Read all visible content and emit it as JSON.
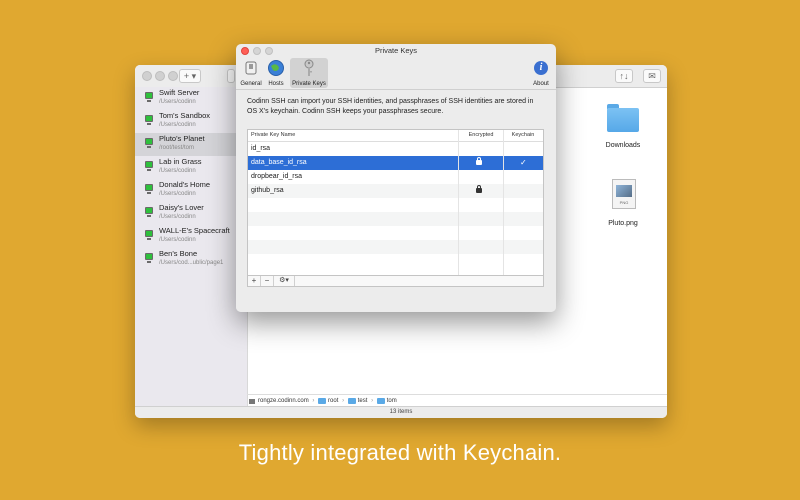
{
  "background_window": {
    "toolbar": {
      "add_label": "+",
      "sort_label": "↑↓"
    },
    "sidebar": {
      "items": [
        {
          "name": "Swift Server",
          "path": "/Users/codinn"
        },
        {
          "name": "Tom's Sandbox",
          "path": "/Users/codinn"
        },
        {
          "name": "Pluto's Planet",
          "path": "/root/test/tom",
          "selected": true
        },
        {
          "name": "Lab in Grass",
          "path": "/Users/codinn"
        },
        {
          "name": "Donald's Home",
          "path": "/Users/codinn"
        },
        {
          "name": "Daisy's Lover",
          "path": "/Users/codinn"
        },
        {
          "name": "WALL-E's Spacecraft",
          "path": "/Users/codinn"
        },
        {
          "name": "Ben's Bone",
          "path": "/Users/cod...ublic/page1"
        }
      ]
    },
    "files": {
      "downloads": "Downloads",
      "pluto_png": "Pluto.png",
      "png_badge": "PNG"
    },
    "path_bar": {
      "host": "rongze.codinn.com",
      "parts": [
        "root",
        "test",
        "tom"
      ],
      "separator": "›"
    },
    "status": "13 items"
  },
  "prefs": {
    "title": "Private Keys",
    "tabs": {
      "general": "General",
      "hosts": "Hosts",
      "private_keys": "Private Keys",
      "about": "About"
    },
    "description": "Codinn SSH can import your SSH identities, and passphrases of SSH identities are stored in OS X's keychain. Codinn SSH keeps your passphrases secure.",
    "columns": {
      "name": "Private Key Name",
      "encrypted": "Encrypted",
      "keychain": "Keychain"
    },
    "keys": [
      {
        "name": "id_rsa",
        "encrypted": false,
        "keychain": false
      },
      {
        "name": "data_base_id_rsa",
        "encrypted": true,
        "keychain": true,
        "selected": true
      },
      {
        "name": "dropbear_id_rsa",
        "encrypted": false,
        "keychain": false
      },
      {
        "name": "github_rsa",
        "encrypted": true,
        "keychain": false
      }
    ],
    "buttons": {
      "add": "+",
      "remove": "−",
      "help": "?",
      "about_glyph": "i",
      "check": "✓"
    }
  },
  "caption": "Tightly integrated with Keychain.",
  "colors": {
    "background": "#e0a830",
    "selection": "#2d6ed6",
    "server_status": "#2fbf3d",
    "folder": "#5aa9e6"
  }
}
